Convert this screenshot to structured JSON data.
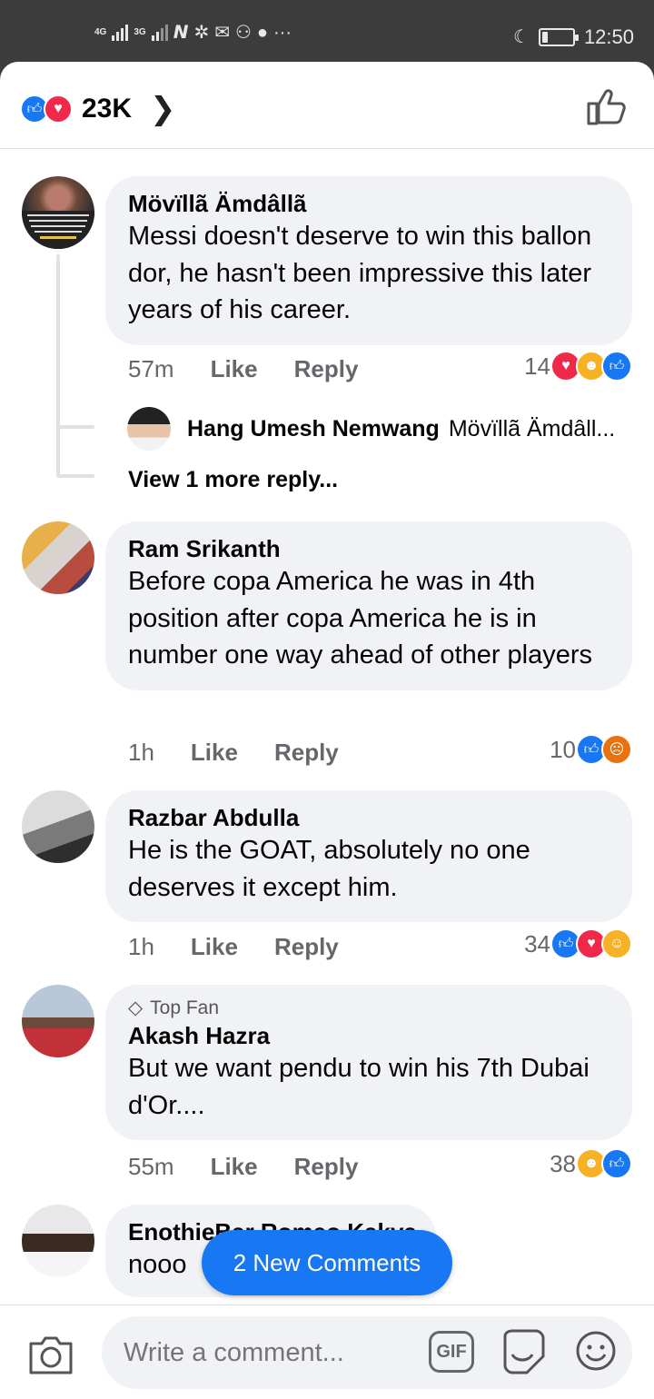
{
  "status_bar": {
    "net1": "4G",
    "net2": "3G",
    "battery_level": 0.2,
    "time": "12:50"
  },
  "header": {
    "reaction_icons": [
      "like",
      "love"
    ],
    "reaction_count": "23K",
    "colors": {
      "like": "#1877f2",
      "love": "#f02849"
    }
  },
  "comments": [
    {
      "author": "Mövïllã Ämdâllã",
      "text": "Messi doesn't deserve to win this ballon dor, he hasn't been impressive this later years of his career.",
      "time": "57m",
      "like_label": "Like",
      "reply_label": "Reply",
      "reaction_count": "14",
      "reactions": [
        "love",
        "haha",
        "like"
      ],
      "reply": {
        "author": "Hang Umesh Nemwang",
        "preview": "Mövïllã Ämdâll..."
      },
      "more_replies": "View 1 more reply..."
    },
    {
      "author": "Ram Srikanth",
      "text": "Before copa America he was in 4th position after copa America he is in number one way ahead of other players",
      "time": "1h",
      "like_label": "Like",
      "reply_label": "Reply",
      "reaction_count": "10",
      "reactions": [
        "like",
        "angry"
      ]
    },
    {
      "author": "Razbar Abdulla",
      "text": "He is the GOAT, absolutely no one deserves it except him.",
      "time": "1h",
      "like_label": "Like",
      "reply_label": "Reply",
      "reaction_count": "34",
      "reactions": [
        "like",
        "love",
        "care"
      ]
    },
    {
      "badge": "Top Fan",
      "author": "Akash Hazra",
      "text": "But we want pendu to win his 7th Dubai d'Or....",
      "time": "55m",
      "like_label": "Like",
      "reply_label": "Reply",
      "reaction_count": "38",
      "reactions": [
        "haha",
        "like"
      ]
    },
    {
      "author": "EnothieBar Romeo Kakva",
      "text": "nooo"
    }
  ],
  "new_comments_label": "2 New Comments",
  "composer": {
    "placeholder": "Write a comment...",
    "gif_label": "GIF"
  }
}
